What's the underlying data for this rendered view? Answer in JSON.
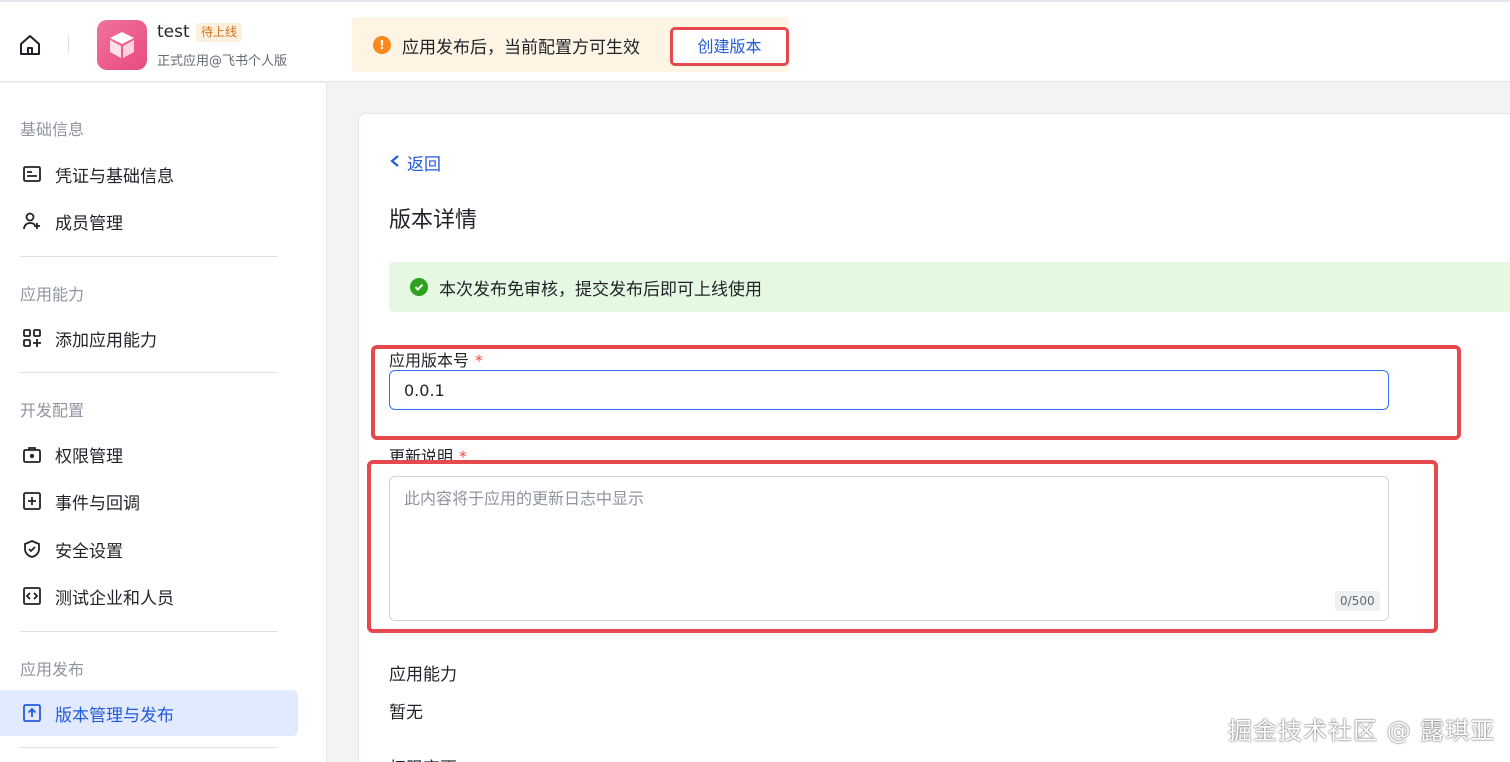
{
  "header": {
    "app_name": "test",
    "app_badge": "待上线",
    "app_subtitle": "正式应用@飞书个人版",
    "notice_text": "应用发布后，当前配置方可生效",
    "create_version_label": "创建版本"
  },
  "sidebar": {
    "sections": [
      {
        "title": "基础信息",
        "items": [
          {
            "label": "凭证与基础信息",
            "icon": "id-card-icon"
          },
          {
            "label": "成员管理",
            "icon": "user-add-icon"
          }
        ]
      },
      {
        "title": "应用能力",
        "items": [
          {
            "label": "添加应用能力",
            "icon": "grid-add-icon"
          }
        ]
      },
      {
        "title": "开发配置",
        "items": [
          {
            "label": "权限管理",
            "icon": "lock-icon"
          },
          {
            "label": "事件与回调",
            "icon": "plus-square-icon"
          },
          {
            "label": "安全设置",
            "icon": "shield-icon"
          },
          {
            "label": "测试企业和人员",
            "icon": "code-icon"
          }
        ]
      },
      {
        "title": "应用发布",
        "items": [
          {
            "label": "版本管理与发布",
            "icon": "upload-icon",
            "active": true
          }
        ]
      }
    ]
  },
  "main": {
    "back_label": "返回",
    "title": "版本详情",
    "success_text": "本次发布免审核，提交发布后即可上线使用",
    "version_label": "应用版本号",
    "version_value": "0.0.1",
    "notes_label": "更新说明",
    "notes_placeholder": "此内容将于应用的更新日志中显示",
    "notes_counter": "0/500",
    "capabilities_label": "应用能力",
    "capabilities_value": "暂无",
    "permissions_label": "权限变更"
  },
  "watermark": "掘金技术社区 @ 露琪亚",
  "colors": {
    "accent": "#245bdb",
    "highlight_border": "#e5484d",
    "success_bg": "#e4f8e2",
    "warning_bg": "#fef4e4"
  }
}
